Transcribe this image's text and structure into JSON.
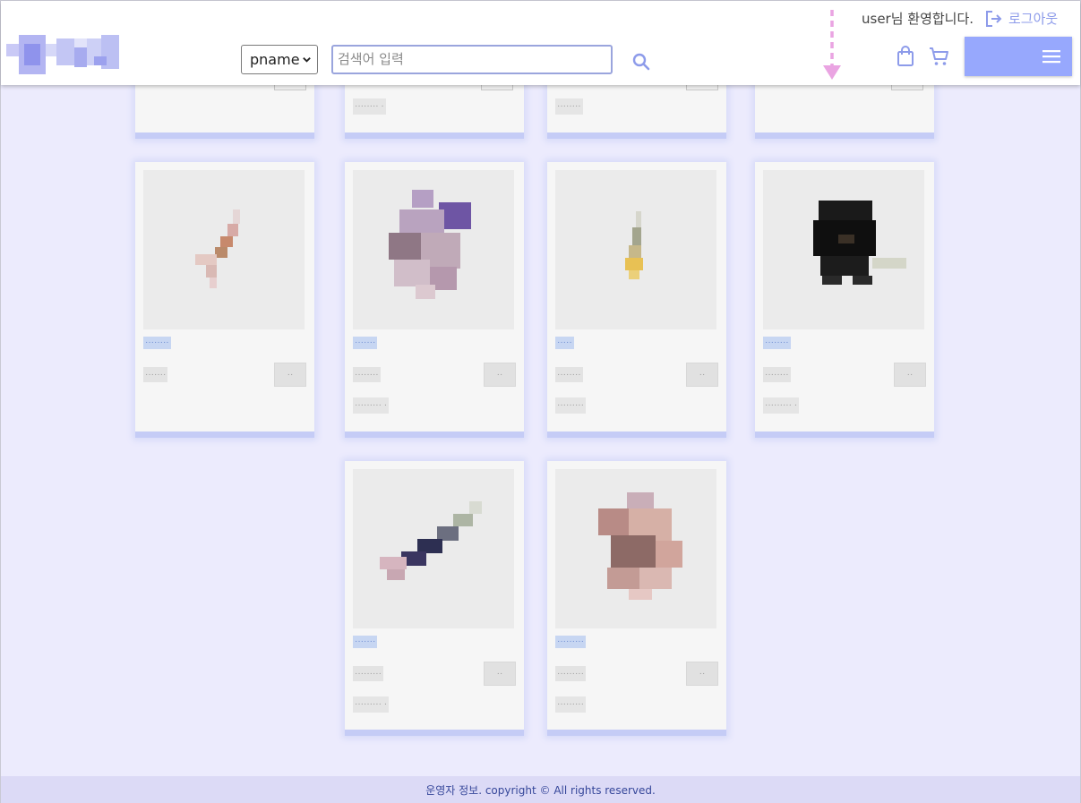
{
  "header": {
    "logo_alt": "logo",
    "search": {
      "select_value": "pname",
      "placeholder": "검색어 입력"
    },
    "welcome_text": "user님 환영합니다.",
    "logout_label": "로그아웃",
    "icons": {
      "search": "search-icon",
      "logout": "logout-icon",
      "bag": "shopping-bag-icon",
      "cart": "shopping-cart-icon",
      "menu": "hamburger-menu-icon",
      "drag": "dashed-arrow-down-icon"
    },
    "accent_color": "#97a8fd"
  },
  "products_row1_partial": [
    {
      "stock": "········  ·"
    },
    {
      "stock": "········  ·"
    },
    {
      "stock": "········"
    },
    {
      "stock": ""
    }
  ],
  "products": [
    {
      "name": "········",
      "price": "·······",
      "button": "··",
      "stock": ""
    },
    {
      "name": "·······",
      "price": "········",
      "button": "··",
      "stock": "·········  ·"
    },
    {
      "name": "·····",
      "price": "········",
      "button": "··",
      "stock": "·········"
    },
    {
      "name": "········",
      "price": "········",
      "button": "··",
      "stock": "·········  ·"
    },
    {
      "name": "·······",
      "price": "·········",
      "button": "··",
      "stock": "·········  ·"
    },
    {
      "name": "·········",
      "price": "·········",
      "button": "··",
      "stock": "·········"
    }
  ],
  "footer": {
    "text": "운영자 정보. copyright © All rights reserved."
  }
}
